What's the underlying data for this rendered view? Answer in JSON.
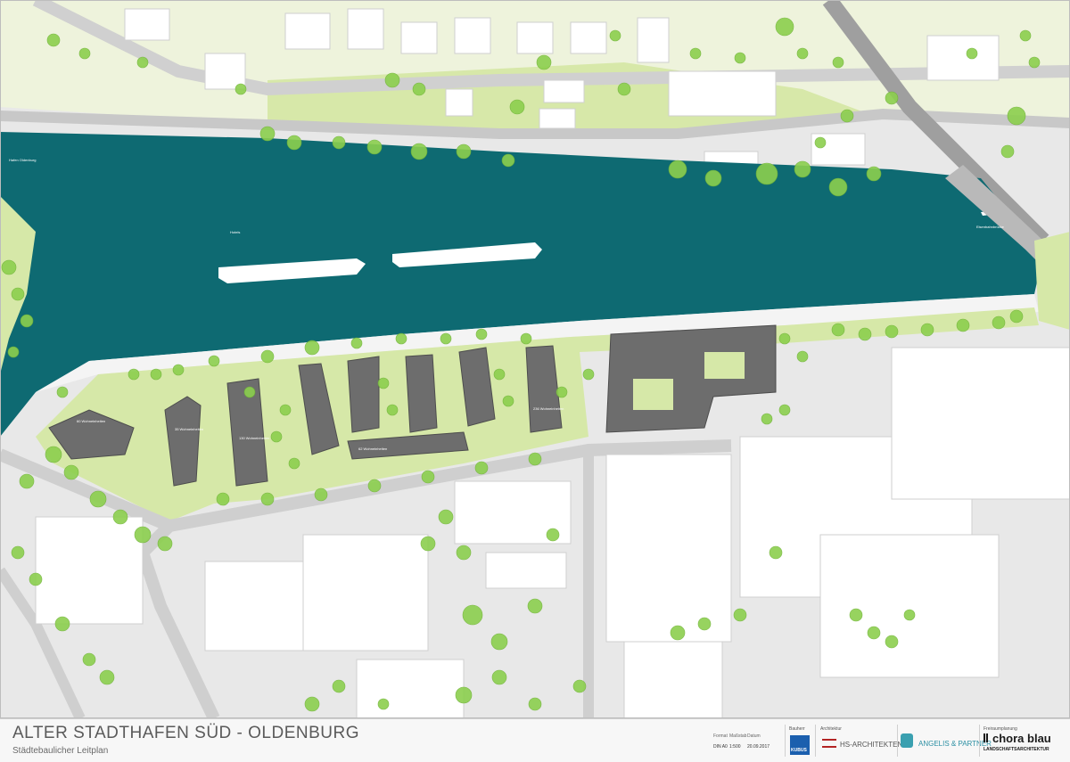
{
  "title": "ALTER STADTHAFEN SÜD  - OLDENBURG",
  "subtitle": "Städtebaulicher Leitplan",
  "meta": {
    "format_label": "Format",
    "format_value": "DIN A0",
    "scale_label": "Maßstab",
    "scale_value": "1:500",
    "date_label": "Datum",
    "date_value": "20.09.2017"
  },
  "partners": {
    "client_label": "Bauherr",
    "client_logo": "KUBUS",
    "architects_label": "Architektur",
    "hs": "HS-ARCHITEKTEN",
    "angelis": "ANGELIS & PARTNER",
    "landscape_label": "Freiraumplanung",
    "chora": "chora blau",
    "chora_sub": "LANDSCHAFTSARCHITEKTUR"
  },
  "map_labels": {
    "harbor": "Hafen Oldenburg",
    "bridge": "Eisenbahnbrücke",
    "ship": "Hotels",
    "bldg_a": "60 Wohneinheiten",
    "bldg_b": "35 Wohneinheiten",
    "bldg_c": "130 Wohneinheiten",
    "bldg_d": "62 Wohneinheiten",
    "bldg_e": "236 Wohneinheiten"
  },
  "colors": {
    "water": "#0e6a72",
    "lawn": "#d3e7a4",
    "tree": "#8ccf4e",
    "building_light": "#ffffff",
    "building_dark": "#6d6d6d",
    "road": "#bdbdbd",
    "accent_blue": "#1b7ac8"
  }
}
